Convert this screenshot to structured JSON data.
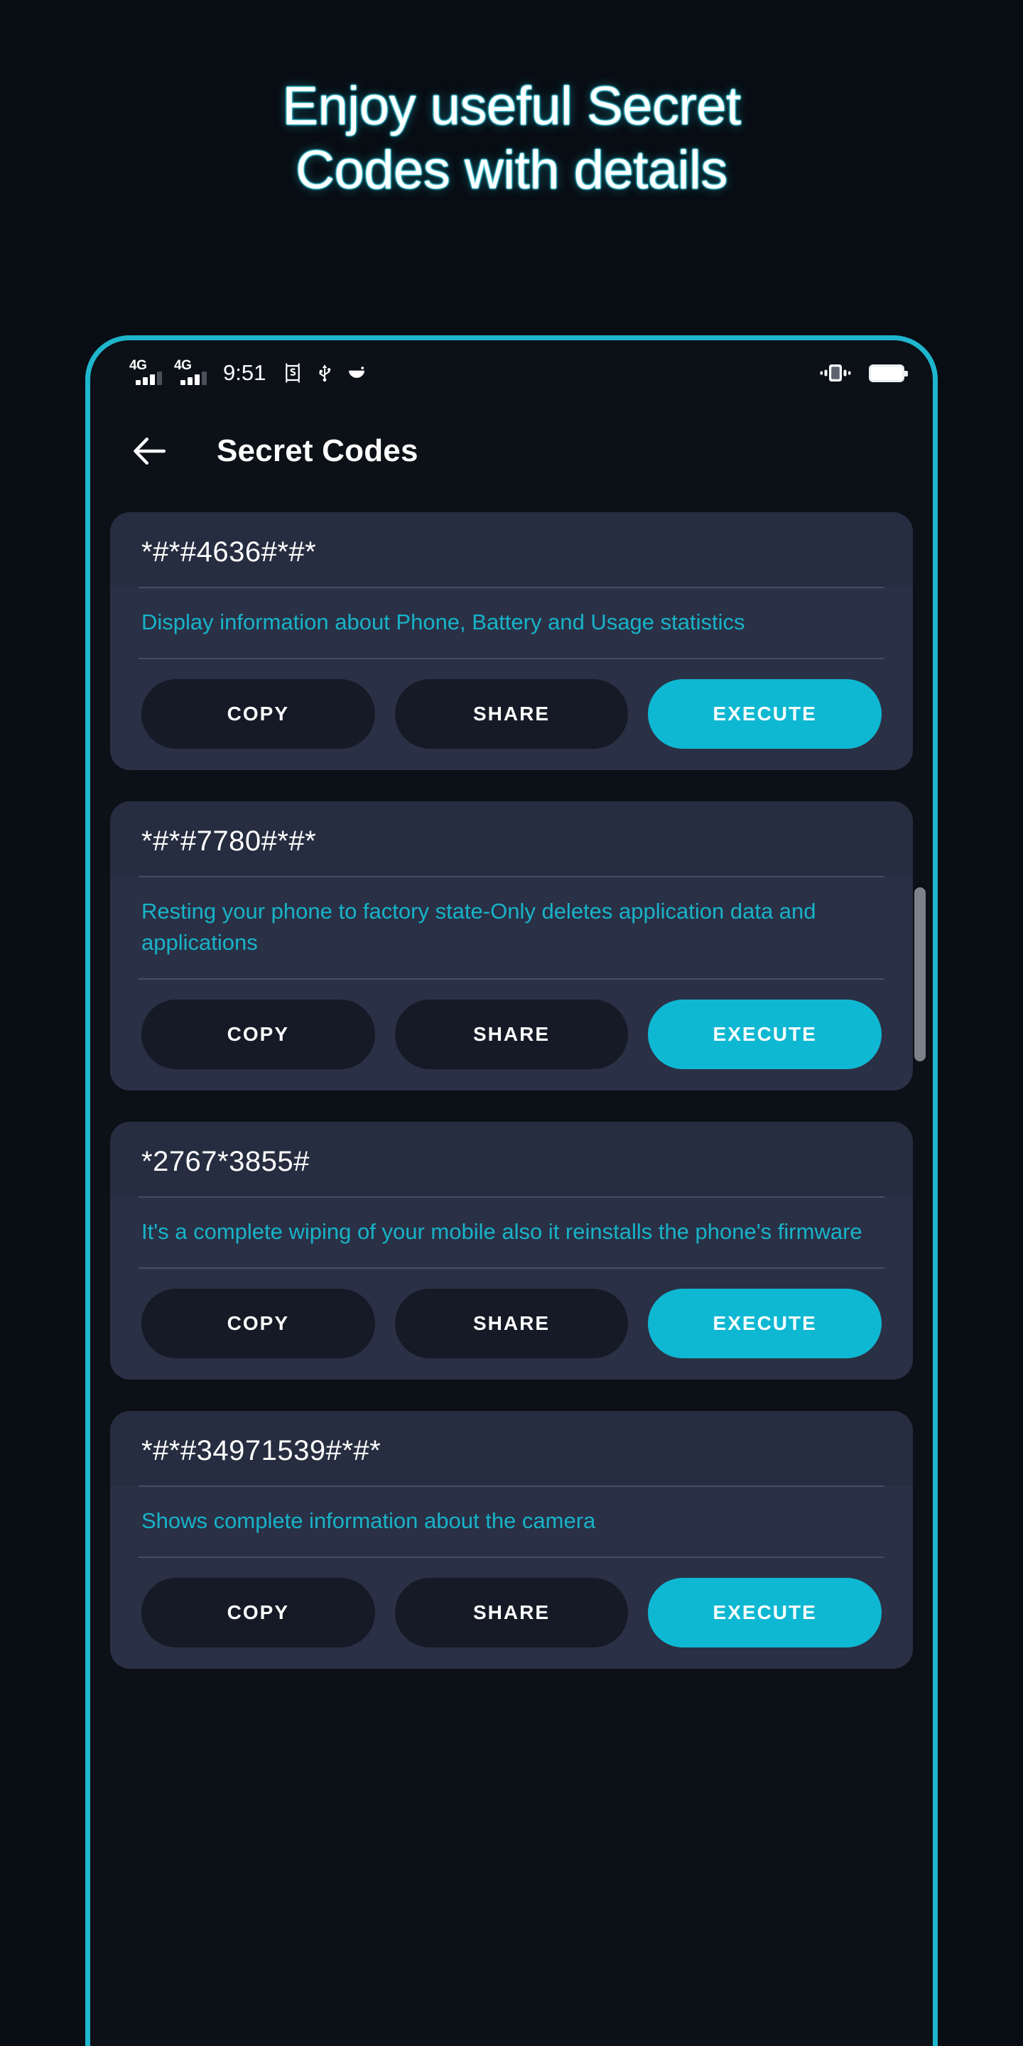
{
  "promo": {
    "line1": "Enjoy useful Secret",
    "line2": "Codes with details"
  },
  "colors": {
    "page_background": "#080d14",
    "phone_border": "#1fb6cd",
    "screen_background": "#0c1017",
    "card_background": "#2a3045",
    "card_header_background": "#272d40",
    "accent": "#0fb8d2",
    "description_text": "#18b3c9",
    "button_dark": "#151a26",
    "scrollbar": "#7b8289"
  },
  "statusbar": {
    "networks": [
      {
        "generation": "4G",
        "bars": 3
      },
      {
        "generation": "4G",
        "bars": 3
      }
    ],
    "time": "9:51",
    "icons": [
      "screenshot-icon",
      "usb-icon",
      "touch-assist-icon"
    ],
    "right_icons": [
      "vibrate-icon",
      "battery-full-icon"
    ]
  },
  "appbar": {
    "back_icon": "back-arrow-icon",
    "title": "Secret Codes"
  },
  "buttons": {
    "copy": "COPY",
    "share": "SHARE",
    "execute": "EXECUTE"
  },
  "cards": [
    {
      "code": "*#*#4636#*#*",
      "description": "Display information about Phone, Battery and Usage statistics"
    },
    {
      "code": "*#*#7780#*#*",
      "description": "Resting your phone to factory state-Only deletes application data and applications"
    },
    {
      "code": "*2767*3855#",
      "description": "It's a complete wiping of your mobile also it reinstalls the phone's firmware"
    },
    {
      "code": "*#*#34971539#*#*",
      "description": "Shows complete information about the camera"
    }
  ]
}
